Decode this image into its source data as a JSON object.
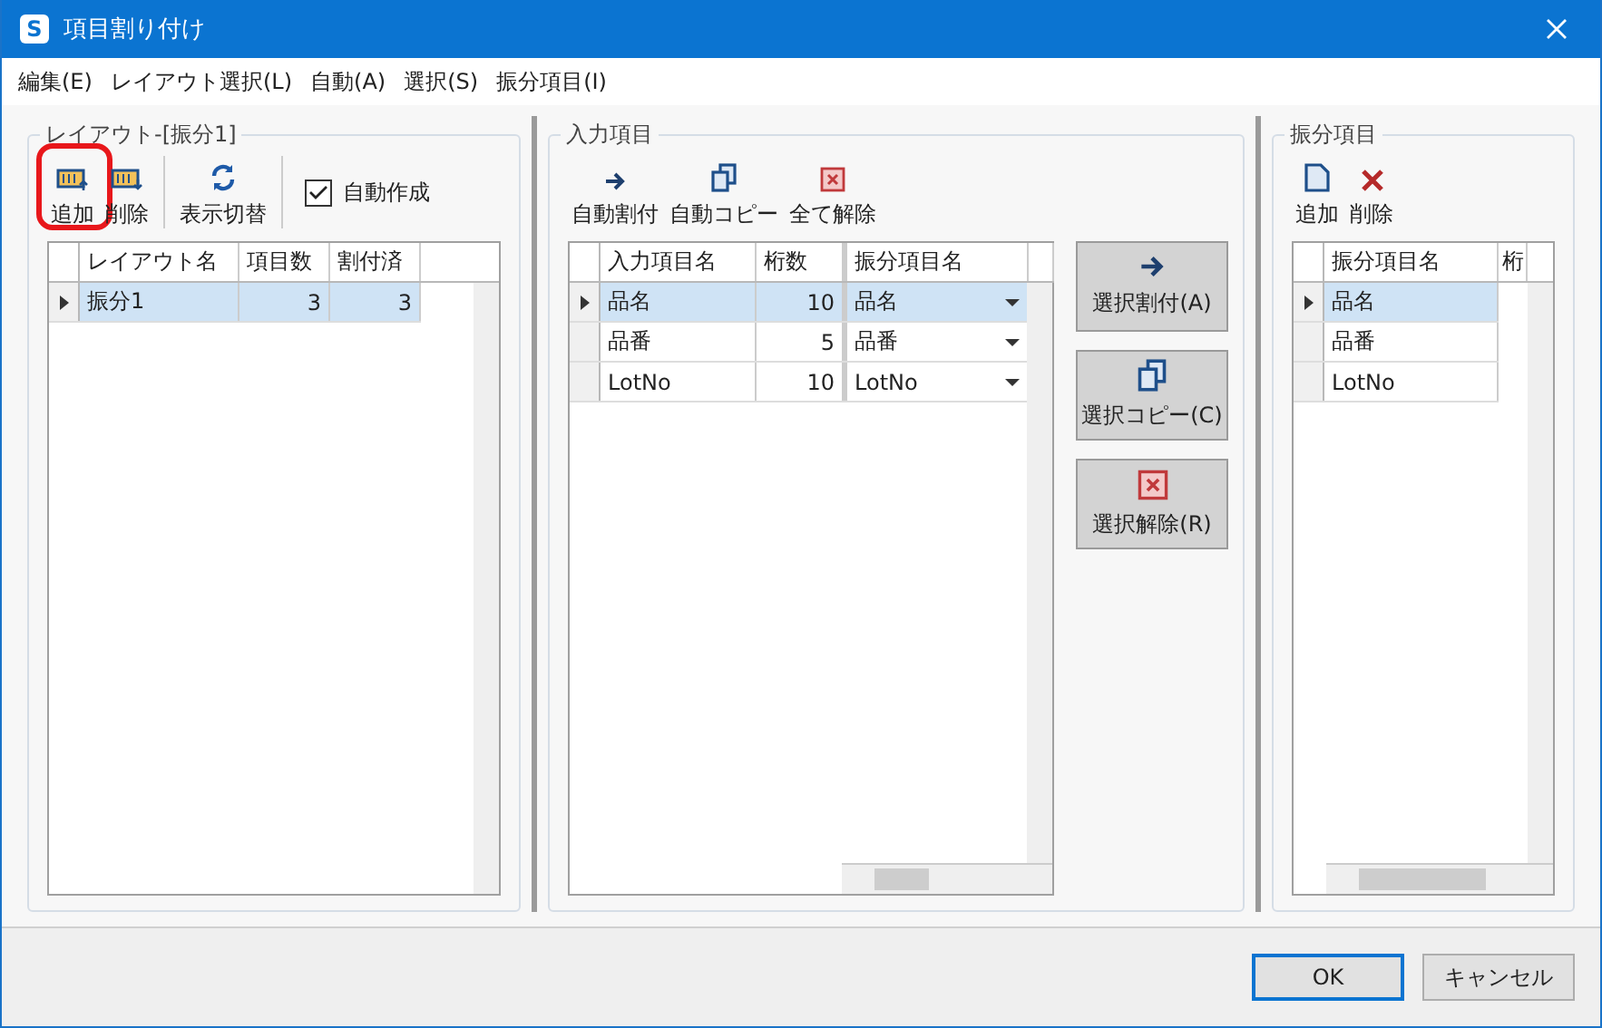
{
  "window": {
    "logo": "S",
    "title": "項目割り付け"
  },
  "menu": [
    "編集(E)",
    "レイアウト選択(L)",
    "自動(A)",
    "選択(S)",
    "振分項目(I)"
  ],
  "layout_panel": {
    "title": "レイアウト-[振分1]",
    "toolbar": [
      {
        "kind": "add",
        "label": "追加",
        "highlighted": true
      },
      {
        "kind": "delete",
        "label": "削除",
        "highlighted": false
      },
      {
        "kind": "refresh",
        "label": "表示切替",
        "highlighted": false
      }
    ],
    "auto_create": {
      "label": "自動作成",
      "checked": true
    },
    "columns": [
      "レイアウト名",
      "項目数",
      "割付済"
    ],
    "rows": [
      {
        "cells": [
          "振分1",
          "3",
          "3"
        ],
        "selected": true
      }
    ]
  },
  "input_panel": {
    "title": "入力項目",
    "toolbar": [
      {
        "kind": "arrow",
        "label": "自動割付"
      },
      {
        "kind": "copy",
        "label": "自動コピー"
      },
      {
        "kind": "clear",
        "label": "全て解除"
      }
    ],
    "columns": [
      "入力項目名",
      "桁数",
      "振分項目名"
    ],
    "rows": [
      {
        "cells": [
          "品名",
          "10",
          "品名"
        ],
        "selected": true
      },
      {
        "cells": [
          "品番",
          "5",
          "品番"
        ],
        "selected": false
      },
      {
        "cells": [
          "LotNo",
          "10",
          "LotNo"
        ],
        "selected": false
      }
    ]
  },
  "side_buttons": [
    {
      "kind": "arrow",
      "label": "選択割付(A)"
    },
    {
      "kind": "copy",
      "label": "選択コピー(C)"
    },
    {
      "kind": "clear",
      "label": "選択解除(R)"
    }
  ],
  "distrib_panel": {
    "title": "振分項目",
    "toolbar": [
      {
        "kind": "page",
        "label": "追加"
      },
      {
        "kind": "cross",
        "label": "削除"
      }
    ],
    "columns": [
      "振分項目名",
      "桁"
    ],
    "rows": [
      {
        "cells": [
          "品名"
        ],
        "selected": true
      },
      {
        "cells": [
          "品番"
        ],
        "selected": false
      },
      {
        "cells": [
          "LotNo"
        ],
        "selected": false
      }
    ]
  },
  "buttons": [
    {
      "label": "OK",
      "default": true
    },
    {
      "label": "キャンセル",
      "default": false
    }
  ]
}
